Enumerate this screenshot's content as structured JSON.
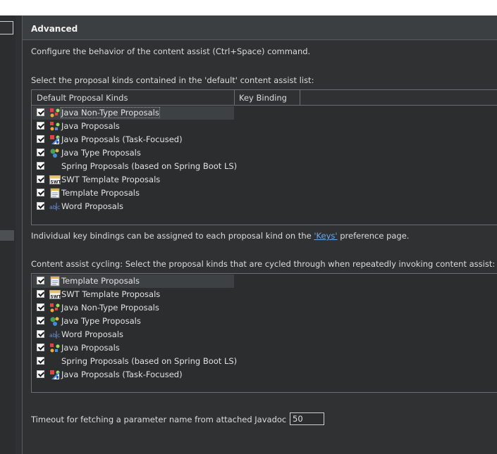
{
  "section_title": "Advanced",
  "description": "Configure the behavior of the content assist (Ctrl+Space) command.",
  "default_list_label": "Select the proposal kinds contained in the 'default' content assist list:",
  "default_table": {
    "columns": [
      "Default Proposal Kinds",
      "Key Binding"
    ],
    "rows": [
      {
        "label": "Java Non-Type Proposals",
        "icon": "java-nontype-icon",
        "checked": true
      },
      {
        "label": "Java Proposals",
        "icon": "java-proposals-icon",
        "checked": true
      },
      {
        "label": "Java Proposals (Task-Focused)",
        "icon": "task-focused-icon",
        "checked": true
      },
      {
        "label": "Java Type Proposals",
        "icon": "java-type-icon",
        "checked": true
      },
      {
        "label": "Spring Proposals (based on Spring Boot LS)",
        "icon": "",
        "checked": true
      },
      {
        "label": "SWT Template Proposals",
        "icon": "swt-icon",
        "checked": true
      },
      {
        "label": "Template Proposals",
        "icon": "template-icon",
        "checked": true
      },
      {
        "label": "Word Proposals",
        "icon": "word-icon",
        "checked": true
      }
    ]
  },
  "keybinding_text_before": "Individual key bindings can be assigned to each proposal kind on the ",
  "keybinding_link": "'Keys'",
  "keybinding_text_after": " preference page.",
  "cycling_label": "Content assist cycling: Select the proposal kinds that are cycled through when repeatedly invoking content assist:",
  "cycling_table": {
    "rows": [
      {
        "label": "Template Proposals",
        "icon": "template-icon",
        "checked": true
      },
      {
        "label": "SWT Template Proposals",
        "icon": "swt-icon",
        "checked": true
      },
      {
        "label": "Java Non-Type Proposals",
        "icon": "java-nontype-icon",
        "checked": true
      },
      {
        "label": "Java Type Proposals",
        "icon": "java-type-icon",
        "checked": true
      },
      {
        "label": "Word Proposals",
        "icon": "word-icon",
        "checked": true
      },
      {
        "label": "Java Proposals",
        "icon": "java-proposals-icon",
        "checked": true
      },
      {
        "label": "Spring Proposals (based on Spring Boot LS)",
        "icon": "",
        "checked": true
      },
      {
        "label": "Java Proposals (Task-Focused)",
        "icon": "task-focused-icon",
        "checked": true
      }
    ]
  },
  "timeout_label": "Timeout for fetching a parameter name from attached Javadoc (ms):",
  "timeout_value": "50"
}
